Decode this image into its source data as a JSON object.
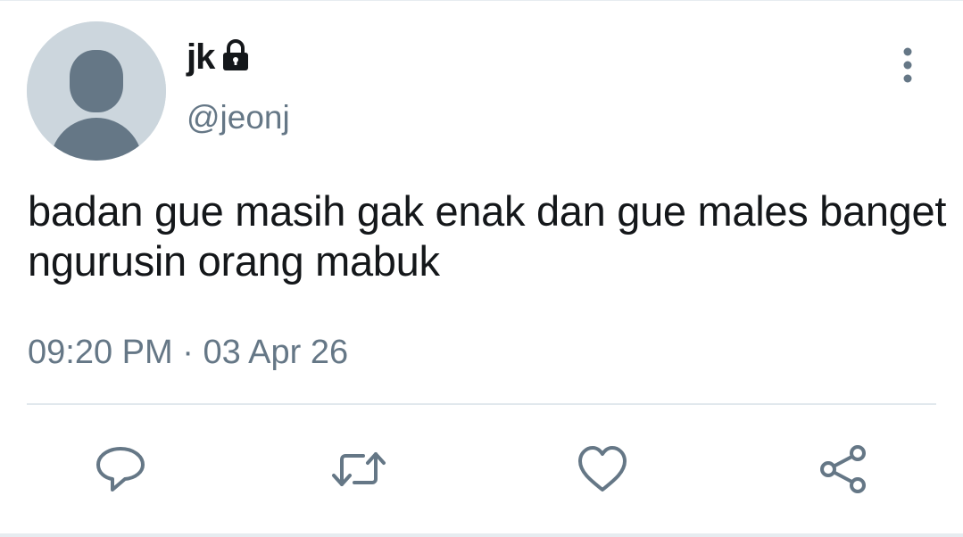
{
  "user": {
    "display_name": "jk",
    "handle": "@jeonj",
    "protected_icon": "lock-icon",
    "avatar": "default-avatar"
  },
  "tweet": {
    "text": "badan gue masih gak enak dan gue males banget ngurusin orang mabuk",
    "time": "09:20 PM",
    "separator": "·",
    "date": "03 Apr 26"
  },
  "actions": [
    {
      "icon": "reply-icon"
    },
    {
      "icon": "retweet-icon"
    },
    {
      "icon": "like-icon"
    },
    {
      "icon": "share-icon"
    }
  ],
  "colors": {
    "primary_text": "#14171a",
    "secondary_text": "#657786",
    "avatar_bg": "#ccd6dd",
    "avatar_figure": "#657786",
    "divider": "#e1e8ed"
  }
}
